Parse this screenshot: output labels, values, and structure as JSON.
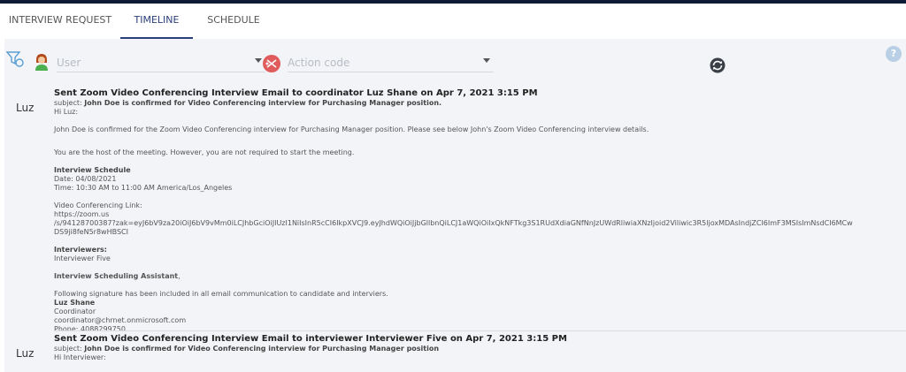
{
  "tabs": [
    {
      "label": "INTERVIEW REQUEST"
    },
    {
      "label": "TIMELINE"
    },
    {
      "label": "SCHEDULE"
    }
  ],
  "filters": {
    "user_placeholder": "User",
    "action_placeholder": "Action code",
    "help_label": "?"
  },
  "colors": {
    "accent": "#2a3f7a",
    "top_bar": "#0d1b36",
    "panel_bg": "#f2f4f7"
  },
  "entries": [
    {
      "author": "Luz",
      "title": "Sent Zoom Video Conferencing Interview Email to coordinator Luz Shane on Apr 7, 2021 3:15 PM",
      "subject_label": "subject:",
      "subject_text": "John Doe is confirmed for Video Conferencing interview for Purchasing Manager position.",
      "greeting": "Hi Luz:",
      "p1": "John Doe is confirmed for the Zoom Video Conferencing interview for Purchasing Manager position. Please see below John's Zoom Video Conferencing interview details.",
      "p2": "You are the host of the meeting. However, you are not required to start the meeting.",
      "schedule_heading": "Interview Schedule",
      "schedule_date": "Date: 04/08/2021",
      "schedule_time": "Time: 10:30 AM to 11:00 AM America/Los_Angeles",
      "link_heading": "Video Conferencing Link:",
      "link_line1": "https://zoom.us",
      "link_line2": "/s/94128700387?zak=eyJ6bV9za20iOiJ6bV9vMm0iLCJhbGciOiJIUzI1NiIsInR5cCI6IkpXVCJ9.eyJhdWQiOiJjbGllbnQiLCJ1aWQiOiIxQkNFTkg3S1RUdXdiaGNfNnJzUWdRliwiaXNzIjoid2Viliwic3R5ljoxMDAsIndjZCI6ImF3MSIsImNsdCI6MCw",
      "link_line3": "DS9ji8feN5r8wHBSCI",
      "interviewers_heading": "Interviewers:",
      "interviewer": "Interviewer Five",
      "assistant_heading": "Interview Scheduling Assistant",
      "assistant_suffix": ",",
      "signature_note": "Following signature has been included in all email communication to candidate and interviers.",
      "sig_name": "Luz Shane",
      "sig_role": "Coordinator",
      "sig_email": "coordinator@chrnet.onmicrosoft.com",
      "sig_phone": "Phone: 4088299750"
    },
    {
      "author": "Luz",
      "title": "Sent Zoom Video Conferencing Interview Email to interviewer Interviewer Five on Apr 7, 2021 3:15 PM",
      "subject_label": "subject:",
      "subject_text": "John Doe is confirmed for Video Conferencing interview for Purchasing Manager position",
      "greeting": "Hi Interviewer:"
    }
  ]
}
